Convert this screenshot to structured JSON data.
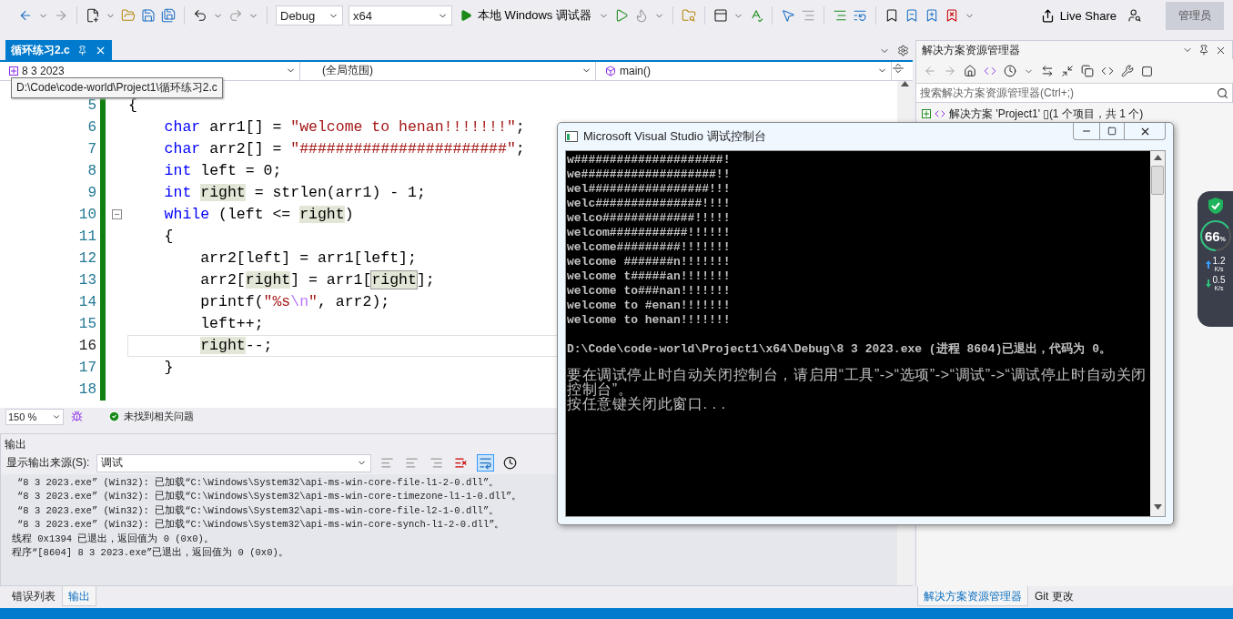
{
  "toolbar": {
    "configuration": "Debug",
    "platform": "x64",
    "run_label": "本地 Windows 调试器",
    "live_share": "Live Share",
    "admin_badge": "管理员"
  },
  "editor": {
    "tab": {
      "label": "循环练习2.c",
      "selected": true
    },
    "nav": {
      "project": "8 3 2023",
      "scope": "(全局范围)",
      "member": "main()"
    },
    "tooltip": "D:\\Code\\code-world\\Project1\\循环练习2.c",
    "lines": [
      {
        "number": "5",
        "current": false,
        "foldable": false,
        "tokens": [
          {
            "kind": "plain",
            "text": "{"
          }
        ]
      },
      {
        "number": "6",
        "current": false,
        "foldable": false,
        "tokens": [
          {
            "kind": "keyword",
            "text": "    char"
          },
          {
            "kind": "plain",
            "text": " arr1[] = "
          },
          {
            "kind": "string",
            "text": "\"welcome to henan!!!!!!!\""
          },
          {
            "kind": "plain",
            "text": ";"
          }
        ]
      },
      {
        "number": "7",
        "current": false,
        "foldable": false,
        "tokens": [
          {
            "kind": "keyword",
            "text": "    char"
          },
          {
            "kind": "plain",
            "text": " arr2[] = "
          },
          {
            "kind": "string",
            "text": "\"#######################\""
          },
          {
            "kind": "plain",
            "text": ";"
          }
        ]
      },
      {
        "number": "8",
        "current": false,
        "foldable": false,
        "tokens": [
          {
            "kind": "keyword",
            "text": "    int"
          },
          {
            "kind": "plain",
            "text": " left = 0;"
          }
        ]
      },
      {
        "number": "9",
        "current": false,
        "foldable": false,
        "tokens": [
          {
            "kind": "keyword",
            "text": "    int"
          },
          {
            "kind": "ref",
            "text": " right"
          },
          {
            "kind": "plain",
            "text": " = strlen(arr1) - 1;"
          }
        ]
      },
      {
        "number": "10",
        "current": false,
        "foldable": true,
        "tokens": [
          {
            "kind": "keyword",
            "text": "    while"
          },
          {
            "kind": "plain",
            "text": " (left <= "
          },
          {
            "kind": "ref",
            "text": "right"
          },
          {
            "kind": "plain",
            "text": ")"
          }
        ]
      },
      {
        "number": "11",
        "current": false,
        "foldable": false,
        "tokens": [
          {
            "kind": "plain",
            "text": "    {"
          }
        ]
      },
      {
        "number": "12",
        "current": false,
        "foldable": false,
        "tokens": [
          {
            "kind": "plain",
            "text": "        arr2[left] = arr1[left];"
          }
        ]
      },
      {
        "number": "13",
        "current": false,
        "foldable": false,
        "tokens": [
          {
            "kind": "plain",
            "text": "        arr2["
          },
          {
            "kind": "ref",
            "text": "right"
          },
          {
            "kind": "plain",
            "text": "] = arr1["
          },
          {
            "kind": "match",
            "text": "right"
          },
          {
            "kind": "plain",
            "text": "];"
          }
        ]
      },
      {
        "number": "14",
        "current": false,
        "foldable": false,
        "tokens": [
          {
            "kind": "plain",
            "text": "        printf("
          },
          {
            "kind": "string",
            "text": "\"%s"
          },
          {
            "kind": "escape",
            "text": "\\n"
          },
          {
            "kind": "string",
            "text": "\""
          },
          {
            "kind": "plain",
            "text": ", arr2);"
          }
        ]
      },
      {
        "number": "15",
        "current": false,
        "foldable": false,
        "tokens": [
          {
            "kind": "plain",
            "text": "        left++;"
          }
        ]
      },
      {
        "number": "16",
        "current": true,
        "foldable": false,
        "tokens": [
          {
            "kind": "ref",
            "text": "        right"
          },
          {
            "kind": "plain",
            "text": "--;"
          }
        ]
      },
      {
        "number": "17",
        "current": false,
        "foldable": false,
        "tokens": [
          {
            "kind": "plain",
            "text": "    }"
          }
        ]
      },
      {
        "number": "18",
        "current": false,
        "foldable": false
      }
    ],
    "zoom": "150 %",
    "issues": "未找到相关问题"
  },
  "output": {
    "title": "输出",
    "source_label": "显示输出来源(S):",
    "source": "调试",
    "lines": [
      "“8 3 2023.exe” (Win32): 已加载“C:\\Windows\\System32\\api-ms-win-core-file-l1-2-0.dll”。",
      "“8 3 2023.exe” (Win32): 已加载“C:\\Windows\\System32\\api-ms-win-core-timezone-l1-1-0.dll”。",
      "“8 3 2023.exe” (Win32): 已加载“C:\\Windows\\System32\\api-ms-win-core-file-l2-1-0.dll”。",
      "“8 3 2023.exe” (Win32): 已加载“C:\\Windows\\System32\\api-ms-win-core-synch-l1-2-0.dll”。",
      "线程 0x1394 已退出，返回值为 0 (0x0)。",
      "程序“[8604] 8 3 2023.exe”已退出，返回值为 0 (0x0)。"
    ]
  },
  "bottom_tabs": [
    {
      "label": "错误列表",
      "selected": false
    },
    {
      "label": "输出",
      "selected": true
    }
  ],
  "solution_explorer": {
    "title": "解决方案资源管理器",
    "search": {
      "placeholder": "搜索解决方案资源管理器(Ctrl+;)"
    },
    "tree": [
      {
        "label": "解决方案 'Project1' ▯(1 个项目，共 1 个)"
      }
    ],
    "tabs": [
      {
        "label": "解决方案资源管理器",
        "selected": true
      },
      {
        "label": "Git 更改",
        "selected": false
      }
    ]
  },
  "console": {
    "title": "Microsoft Visual Studio 调试控制台",
    "program_output": [
      "w#####################!",
      "we###################!!",
      "wel#################!!!",
      "welc###############!!!!",
      "welco#############!!!!!",
      "welcom###########!!!!!!",
      "welcome#########!!!!!!!",
      "welcome #######n!!!!!!!",
      "welcome t#####an!!!!!!!",
      "welcome to###nan!!!!!!!",
      "welcome to #enan!!!!!!!",
      "welcome to henan!!!!!!!"
    ],
    "exit_message": "D:\\Code\\code-world\\Project1\\x64\\Debug\\8 3 2023.exe (进程 8604)已退出，代码为 0。",
    "hint": "要在调试停止时自动关闭控制台，请启用“工具”->“选项”->“调试”->“调试停止时自动关闭控制台”。",
    "prompt": "按任意键关闭此窗口. . ."
  },
  "monitor": {
    "percent": "66",
    "percent_sign": "%",
    "level": 0.66,
    "upload": "1.2",
    "upload_unit": "K/s",
    "download": "0.5",
    "download_unit": "K/s"
  }
}
